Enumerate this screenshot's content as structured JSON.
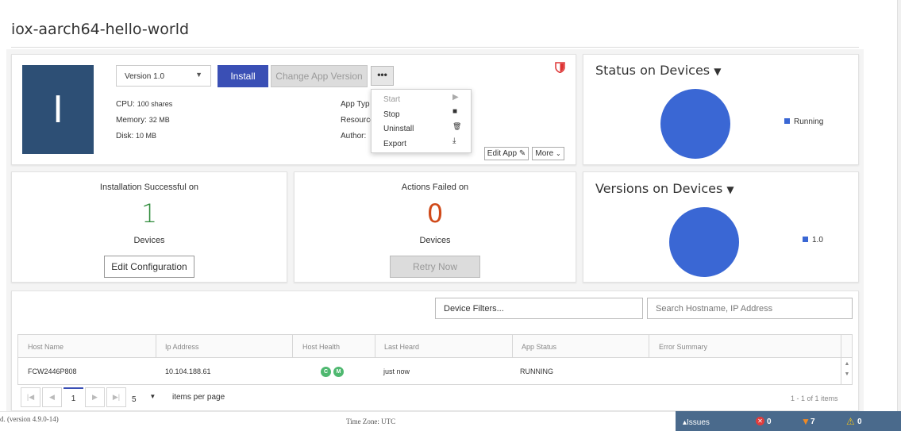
{
  "app": {
    "title": "iox-aarch64-hello-world",
    "tile_letter": "I"
  },
  "header": {
    "version_select": "Version 1.0",
    "install_label": "Install",
    "change_version_label": "Change App Version",
    "more_dots_label": "•••"
  },
  "specs": {
    "cpu_label": "CPU:",
    "cpu_value": "100 shares",
    "memory_label": "Memory:",
    "memory_value": "32 MB",
    "disk_label": "Disk:",
    "disk_value": "10 MB",
    "app_type_label": "App Typ",
    "resource_label": "Resource",
    "author_label": "Author:"
  },
  "action_menu": {
    "items": [
      {
        "label": "Start",
        "icon": "▶",
        "enabled": false
      },
      {
        "label": "Stop",
        "icon": "■",
        "enabled": true
      },
      {
        "label": "Uninstall",
        "icon": "🗑",
        "enabled": true
      },
      {
        "label": "Export",
        "icon": "⤓",
        "enabled": true
      }
    ]
  },
  "buttons": {
    "edit_app": "Edit App",
    "more": "More"
  },
  "install_card": {
    "title": "Installation Successful on",
    "count": "1",
    "unit": "Devices",
    "button": "Edit Configuration",
    "count_color": "#2e8b3a"
  },
  "failed_card": {
    "title": "Actions Failed on",
    "count": "0",
    "unit": "Devices",
    "button": "Retry Now",
    "count_color": "#d04a1a"
  },
  "status_panel": {
    "title": "Status on Devices",
    "legend": "Running"
  },
  "versions_panel": {
    "title": "Versions on Devices",
    "legend": "1.0"
  },
  "chart_data": [
    {
      "type": "pie",
      "title": "Status on Devices",
      "categories": [
        "Running"
      ],
      "values": [
        1
      ],
      "colors": [
        "#3a67d4"
      ]
    },
    {
      "type": "pie",
      "title": "Versions on Devices",
      "categories": [
        "1.0"
      ],
      "values": [
        1
      ],
      "colors": [
        "#3a67d4"
      ]
    }
  ],
  "filters": {
    "device_filters": "Device Filters...",
    "search_placeholder": "Search Hostname, IP Address"
  },
  "table": {
    "headers": [
      "Host Name",
      "Ip Address",
      "Host Health",
      "Last Heard",
      "App Status",
      "Error Summary"
    ],
    "rows": [
      {
        "host": "FCW2446P808",
        "ip": "10.104.188.61",
        "health": [
          "C",
          "M"
        ],
        "last_heard": "just now",
        "status": "RUNNING",
        "error": ""
      }
    ]
  },
  "pager": {
    "page": "1",
    "page_size": "5",
    "items_per_page": "items per page",
    "summary": "1 - 1 of 1 items"
  },
  "footer": {
    "version": "d. (version 4.9.0-14)",
    "timezone": "Time Zone: UTC"
  },
  "issues": {
    "label": "▴Issues",
    "errors": "0",
    "warnings": "7",
    "alerts": "0"
  }
}
